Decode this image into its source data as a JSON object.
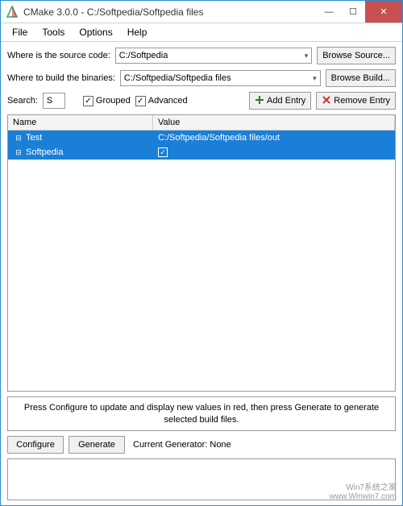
{
  "titlebar": {
    "title": "CMake 3.0.0 - C:/Softpedia/Softpedia files"
  },
  "menu": {
    "file": "File",
    "tools": "Tools",
    "options": "Options",
    "help": "Help"
  },
  "source": {
    "label": "Where is the source code:",
    "value": "C:/Softpedia",
    "browse": "Browse Source..."
  },
  "build": {
    "label": "Where to build the binaries:",
    "value": "C:/Softpedia/Softpedia files",
    "browse": "Browse Build..."
  },
  "search": {
    "label": "Search:",
    "value": "S"
  },
  "grouped": {
    "label": "Grouped",
    "checked": "✓"
  },
  "advanced": {
    "label": "Advanced",
    "checked": "✓"
  },
  "addentry": "Add Entry",
  "removeentry": "Remove Entry",
  "table": {
    "col_name": "Name",
    "col_value": "Value",
    "rows": [
      {
        "name": "Test",
        "value": "C:/Softpedia/Softpedia files/out"
      },
      {
        "name": "Softpedia",
        "value_check": "✓"
      }
    ]
  },
  "hint": "Press Configure to update and display new values in red, then press Generate to generate selected build files.",
  "configure": "Configure",
  "generate": "Generate",
  "generator": "Current Generator: None",
  "watermark": {
    "line1": "Win7系统之家",
    "line2": "www.Winwin7.com"
  }
}
